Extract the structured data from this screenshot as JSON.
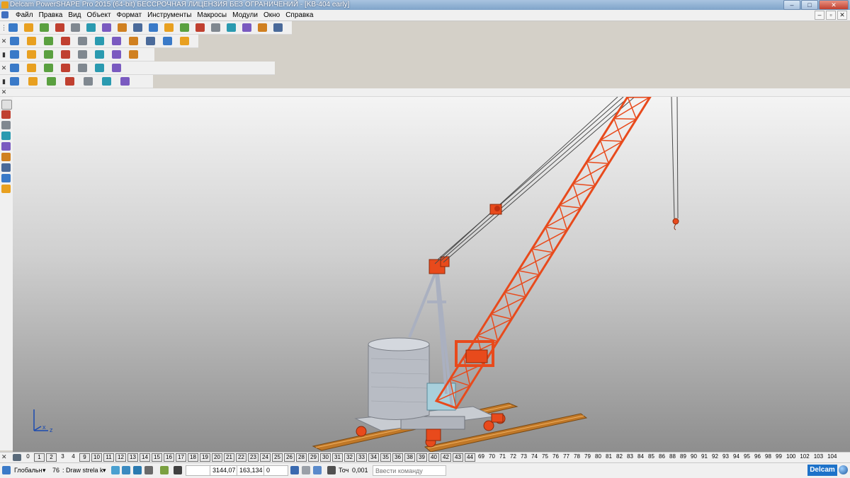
{
  "window": {
    "title": "Delcam PowerSHAPE Pro 2015 (64-bit) БЕССРОЧНАЯ ЛИЦЕНЗИЯ БЕЗ ОГРАНИЧЕНИЙ - [KB-404 early]",
    "minimize_label": "–",
    "maximize_label": "□",
    "close_label": "✕"
  },
  "menu": {
    "items": [
      "Файл",
      "Правка",
      "Вид",
      "Объект",
      "Формат",
      "Инструменты",
      "Макросы",
      "Модули",
      "Окно",
      "Справка"
    ],
    "mdi_minimize": "–",
    "mdi_restore": "▫",
    "mdi_close": "✕"
  },
  "toolbars": {
    "row1_icons": [
      "new-icon",
      "open-icon",
      "save-icon",
      "print-icon",
      "undo-icon",
      "cut-icon",
      "copy-icon",
      "paste-icon",
      "pen-icon",
      "redo-icon",
      "curve-icon",
      "line-icon",
      "circle-icon",
      "arc-icon",
      "surface-icon",
      "solid-icon",
      "mesh-icon",
      "tool-icon"
    ],
    "row2_icons": [
      "view-top-icon",
      "view-front-icon",
      "view-side-icon",
      "view-iso-icon",
      "zoom-in-icon",
      "zoom-out-icon",
      "zoom-fit-icon",
      "rotate-icon",
      "shade-icon",
      "wireframe-icon",
      "light-icon"
    ],
    "row3_icons": [
      "cube-icon",
      "sphere-icon",
      "cone-icon",
      "torus-icon",
      "prism-icon",
      "extrude-icon",
      "revolve-icon",
      "blend-icon"
    ],
    "row4_icons": [
      "select-icon",
      "transform-icon",
      "mirror-icon",
      "offset-icon",
      "scale-icon",
      "move-icon",
      "copy-object-icon"
    ],
    "row5_icons": [
      "assembly-icon",
      "component-icon",
      "measure-icon",
      "section-icon",
      "analysis-icon",
      "render-icon",
      "draft-icon"
    ]
  },
  "left_toolbar": {
    "icons": [
      "select-arrow-icon",
      "feature-icon",
      "surface-tool-icon",
      "solid-tool-icon",
      "plane-icon",
      "primitive-icon",
      "boolean-icon",
      "fillet-icon",
      "sweep-icon"
    ]
  },
  "viewport": {
    "axis_x_label": "x",
    "axis_z_label": "z",
    "scene": "crane-model"
  },
  "levels": {
    "close_label": "✕",
    "items": [
      {
        "label": "0",
        "boxed": false
      },
      {
        "label": "1",
        "boxed": true
      },
      {
        "label": "2",
        "boxed": true
      },
      {
        "label": "3",
        "boxed": false
      },
      {
        "label": "4",
        "boxed": false
      },
      {
        "label": "9",
        "boxed": true
      },
      {
        "label": "10",
        "boxed": true
      },
      {
        "label": "11",
        "boxed": true
      },
      {
        "label": "12",
        "boxed": true
      },
      {
        "label": "13",
        "boxed": true
      },
      {
        "label": "14",
        "boxed": true
      },
      {
        "label": "15",
        "boxed": true
      },
      {
        "label": "16",
        "boxed": true
      },
      {
        "label": "17",
        "boxed": true
      },
      {
        "label": "18",
        "boxed": true
      },
      {
        "label": "19",
        "boxed": true
      },
      {
        "label": "20",
        "boxed": true
      },
      {
        "label": "21",
        "boxed": true
      },
      {
        "label": "22",
        "boxed": true
      },
      {
        "label": "23",
        "boxed": true
      },
      {
        "label": "24",
        "boxed": true
      },
      {
        "label": "25",
        "boxed": true
      },
      {
        "label": "26",
        "boxed": true
      },
      {
        "label": "28",
        "boxed": true
      },
      {
        "label": "29",
        "boxed": true
      },
      {
        "label": "30",
        "boxed": true
      },
      {
        "label": "31",
        "boxed": true
      },
      {
        "label": "32",
        "boxed": true
      },
      {
        "label": "33",
        "boxed": true
      },
      {
        "label": "34",
        "boxed": true
      },
      {
        "label": "35",
        "boxed": true
      },
      {
        "label": "36",
        "boxed": true
      },
      {
        "label": "38",
        "boxed": true
      },
      {
        "label": "39",
        "boxed": true
      },
      {
        "label": "40",
        "boxed": true
      },
      {
        "label": "42",
        "boxed": true
      },
      {
        "label": "43",
        "boxed": true
      },
      {
        "label": "44",
        "boxed": true
      },
      {
        "label": "69",
        "boxed": false
      },
      {
        "label": "70",
        "boxed": false
      },
      {
        "label": "71",
        "boxed": false
      },
      {
        "label": "72",
        "boxed": false
      },
      {
        "label": "73",
        "boxed": false
      },
      {
        "label": "74",
        "boxed": false
      },
      {
        "label": "75",
        "boxed": false
      },
      {
        "label": "76",
        "boxed": false
      },
      {
        "label": "77",
        "boxed": false
      },
      {
        "label": "78",
        "boxed": false
      },
      {
        "label": "79",
        "boxed": false
      },
      {
        "label": "80",
        "boxed": false
      },
      {
        "label": "81",
        "boxed": false
      },
      {
        "label": "82",
        "boxed": false
      },
      {
        "label": "83",
        "boxed": false
      },
      {
        "label": "84",
        "boxed": false
      },
      {
        "label": "85",
        "boxed": false
      },
      {
        "label": "86",
        "boxed": false
      },
      {
        "label": "88",
        "boxed": false
      },
      {
        "label": "89",
        "boxed": false
      },
      {
        "label": "90",
        "boxed": false
      },
      {
        "label": "91",
        "boxed": false
      },
      {
        "label": "92",
        "boxed": false
      },
      {
        "label": "93",
        "boxed": false
      },
      {
        "label": "94",
        "boxed": false
      },
      {
        "label": "95",
        "boxed": false
      },
      {
        "label": "96",
        "boxed": false
      },
      {
        "label": "98",
        "boxed": false
      },
      {
        "label": "99",
        "boxed": false
      },
      {
        "label": "100",
        "boxed": false
      },
      {
        "label": "102",
        "boxed": false
      },
      {
        "label": "103",
        "boxed": false
      },
      {
        "label": "104",
        "boxed": false
      }
    ]
  },
  "status": {
    "workplane": "Глобальн",
    "level_number": "76",
    "level_name": ": Draw strela k",
    "coord_x": "3144,07",
    "coord_y": "163,134",
    "coord_z": "0",
    "tolerance_label": "Точ",
    "tolerance_value": "0,001",
    "command_placeholder": "Ввести команду",
    "brand": "Delcam"
  },
  "colors": {
    "boom_red": "#e84a1c",
    "rail_orange": "#c07828",
    "body_grey": "#b8bcc4"
  }
}
